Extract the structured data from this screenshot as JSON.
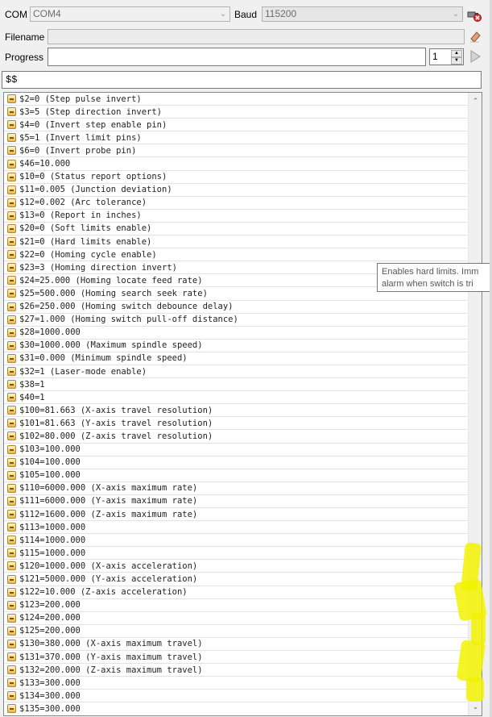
{
  "toolbar": {
    "com_label": "COM",
    "com_value": "COM4",
    "baud_label": "Baud",
    "baud_value": "115200",
    "filename_label": "Filename",
    "filename_value": "",
    "progress_label": "Progress",
    "progress_fraction": 0,
    "repeat_value": "1"
  },
  "command": {
    "value": "$$"
  },
  "list": {
    "items": [
      "$2=0 (Step pulse invert)",
      "$3=5 (Step direction invert)",
      "$4=0 (Invert step enable pin)",
      "$5=1 (Invert limit pins)",
      "$6=0 (Invert probe pin)",
      "$46=10.000",
      "$10=0 (Status report options)",
      "$11=0.005 (Junction deviation)",
      "$12=0.002 (Arc tolerance)",
      "$13=0 (Report in inches)",
      "$20=0 (Soft limits enable)",
      "$21=0 (Hard limits enable)",
      "$22=0 (Homing cycle enable)",
      "$23=3 (Homing direction invert)",
      "$24=25.000 (Homing locate feed rate)",
      "$25=500.000 (Homing search seek rate)",
      "$26=250.000 (Homing switch debounce delay)",
      "$27=1.000 (Homing switch pull-off distance)",
      "$28=1000.000",
      "$30=1000.000 (Maximum spindle speed)",
      "$31=0.000 (Minimum spindle speed)",
      "$32=1 (Laser-mode enable)",
      "$38=1",
      "$40=1",
      "$100=81.663 (X-axis travel resolution)",
      "$101=81.663 (Y-axis travel resolution)",
      "$102=80.000 (Z-axis travel resolution)",
      "$103=100.000",
      "$104=100.000",
      "$105=100.000",
      "$110=6000.000 (X-axis maximum rate)",
      "$111=6000.000 (Y-axis maximum rate)",
      "$112=1600.000 (Z-axis maximum rate)",
      "$113=1000.000",
      "$114=1000.000",
      "$115=1000.000",
      "$120=1000.000 (X-axis acceleration)",
      "$121=5000.000 (Y-axis acceleration)",
      "$122=10.000 (Z-axis acceleration)",
      "$123=200.000",
      "$124=200.000",
      "$125=200.000",
      "$130=380.000 (X-axis maximum travel)",
      "$131=370.000 (Y-axis maximum travel)",
      "$132=200.000 (Z-axis maximum travel)",
      "$133=300.000",
      "$134=300.000",
      "$135=300.000"
    ]
  },
  "tooltip": {
    "line1": "Enables hard limits. Imm",
    "line2": "alarm when switch is tri"
  },
  "icons": {
    "disconnect": "disconnect-plug-icon",
    "eraser": "eraser-icon",
    "play": "play-icon",
    "line": "setting-line-icon"
  },
  "colors": {
    "highlight": "#f2f200",
    "window_bg": "#f0f0f0",
    "field_border": "#b4b4b4"
  }
}
